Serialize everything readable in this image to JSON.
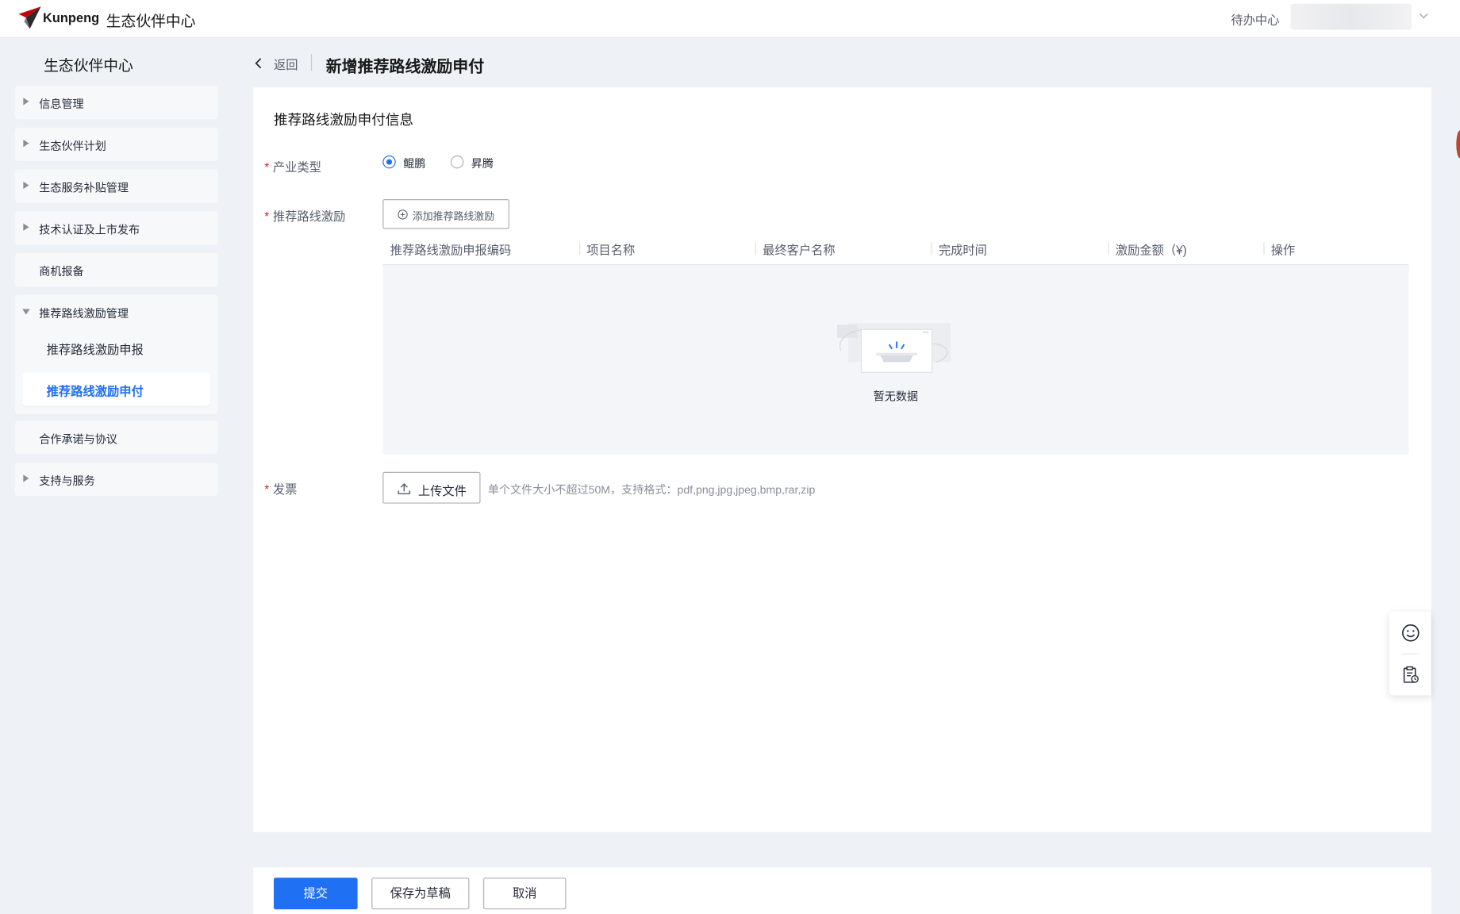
{
  "header": {
    "brand": "Kunpeng",
    "app_title": "生态伙伴中心",
    "todo_label": "待办中心",
    "logo_icon": "kunpeng-logo-icon",
    "accent_color": "#2070f3"
  },
  "sidebar": {
    "title": "生态伙伴中心",
    "items": [
      {
        "label": "信息管理"
      },
      {
        "label": "生态伙伴计划"
      },
      {
        "label": "生态服务补贴管理"
      },
      {
        "label": "技术认证及上市发布"
      },
      {
        "label": "商机报备"
      },
      {
        "label": "推荐路线激励管理"
      },
      {
        "label": "合作承诺与协议"
      },
      {
        "label": "支持与服务"
      }
    ],
    "sub_items": [
      {
        "label": "推荐路线激励申报"
      },
      {
        "label": "推荐路线激励申付"
      }
    ]
  },
  "page": {
    "back_label": "返回",
    "title": "新增推荐路线激励申付"
  },
  "form": {
    "section_title": "推荐路线激励申付信息",
    "industry_type": {
      "label": "产业类型",
      "options": [
        "鲲鹏",
        "昇腾"
      ],
      "selected": "鲲鹏"
    },
    "incentive": {
      "label": "推荐路线激励",
      "add_button": "添加推荐路线激励"
    },
    "table": {
      "columns": [
        "推荐路线激励申报编码",
        "项目名称",
        "最终客户名称",
        "完成时间",
        "激励金额（¥)",
        "操作"
      ],
      "rows": [],
      "empty_text": "暂无数据"
    },
    "invoice": {
      "label": "发票",
      "upload_button": "上传文件",
      "hint": "单个文件大小不超过50M，支持格式：pdf,png,jpg,jpeg,bmp,rar,zip"
    }
  },
  "actions": {
    "submit": "提交",
    "save_draft": "保存为草稿",
    "cancel": "取消"
  },
  "float_panel": {
    "icons": [
      "smiley-feedback-icon",
      "clipboard-clock-icon"
    ]
  }
}
